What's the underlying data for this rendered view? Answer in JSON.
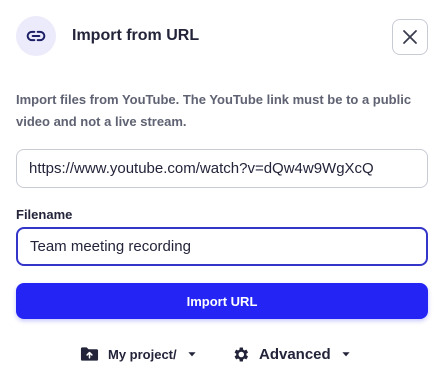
{
  "header": {
    "title": "Import from URL",
    "icon": "link-icon",
    "close_icon": "close-icon"
  },
  "description": "Import files from YouTube. The YouTube link must be to a public video and not a live stream.",
  "url_input": {
    "value": "https://www.youtube.com/watch?v=dQw4w9WgXcQ"
  },
  "filename": {
    "label": "Filename",
    "value": "Team meeting recording"
  },
  "import_button": {
    "label": "Import URL"
  },
  "footer": {
    "folder_label": "My project/",
    "folder_icon": "folder-upload-icon",
    "advanced_label": "Advanced",
    "advanced_icon": "gear-icon"
  },
  "colors": {
    "accent": "#2425f5",
    "focus_border": "#3435c9",
    "badge_bg": "#ecebfb"
  }
}
